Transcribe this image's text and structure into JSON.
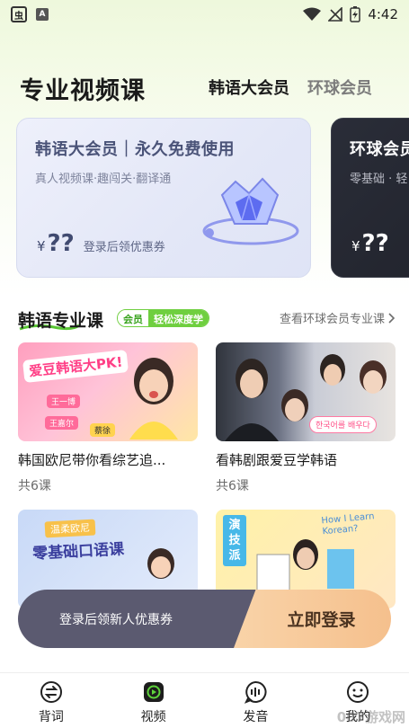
{
  "status_bar": {
    "app_glyph": "虫",
    "a_badge": "A",
    "time": "4:42"
  },
  "header": {
    "title": "专业视频课",
    "tabs": [
      {
        "label": "韩语大会员"
      },
      {
        "label": "环球会员"
      }
    ]
  },
  "member_cards": [
    {
      "title": "韩语大会员｜永久免费使用",
      "subtitle": "真人视频课·趣闯关·翻译通",
      "price_symbol": "¥",
      "price": "??",
      "price_note": "登录后领优惠券"
    },
    {
      "title": "环球会员",
      "subtitle": "零基础 · 轻",
      "price_symbol": "¥",
      "price": "??"
    }
  ],
  "section": {
    "title": "韩语专业课",
    "pill_left": "会员",
    "pill_right": "轻松深度学",
    "more_link": "查看环球会员专业课"
  },
  "courses": [
    {
      "title": "韩国欧尼带你看综艺追...",
      "count": "共6课",
      "thumb_text": "爱豆韩语大PK!",
      "thumb_tags": [
        "王一博",
        "王嘉尔",
        "蔡徐"
      ]
    },
    {
      "title": "看韩剧跟爱豆学韩语",
      "count": "共6课",
      "thumb_text": "한국어를 배우다"
    },
    {
      "title": "",
      "count": "",
      "thumb_tag": "温柔欧尼",
      "thumb_text": "零基础口语课"
    },
    {
      "title": "",
      "count": "",
      "thumb_text": "演技派",
      "thumb_text_2": "How I Learn Korean?"
    }
  ],
  "login_bar": {
    "prompt": "登录后领新人优惠券",
    "button": "立即登录"
  },
  "bottom_nav": [
    {
      "label": "背词",
      "icon": "swap-icon"
    },
    {
      "label": "视频",
      "icon": "video-play-icon"
    },
    {
      "label": "发音",
      "icon": "voice-bubble-icon"
    },
    {
      "label": "我的",
      "icon": "smile-icon"
    }
  ],
  "watermark": "007游戏网",
  "colors": {
    "accent_green": "#6fcf3f",
    "login_dark": "#5b5a70",
    "login_gold": "#f5c08d"
  }
}
